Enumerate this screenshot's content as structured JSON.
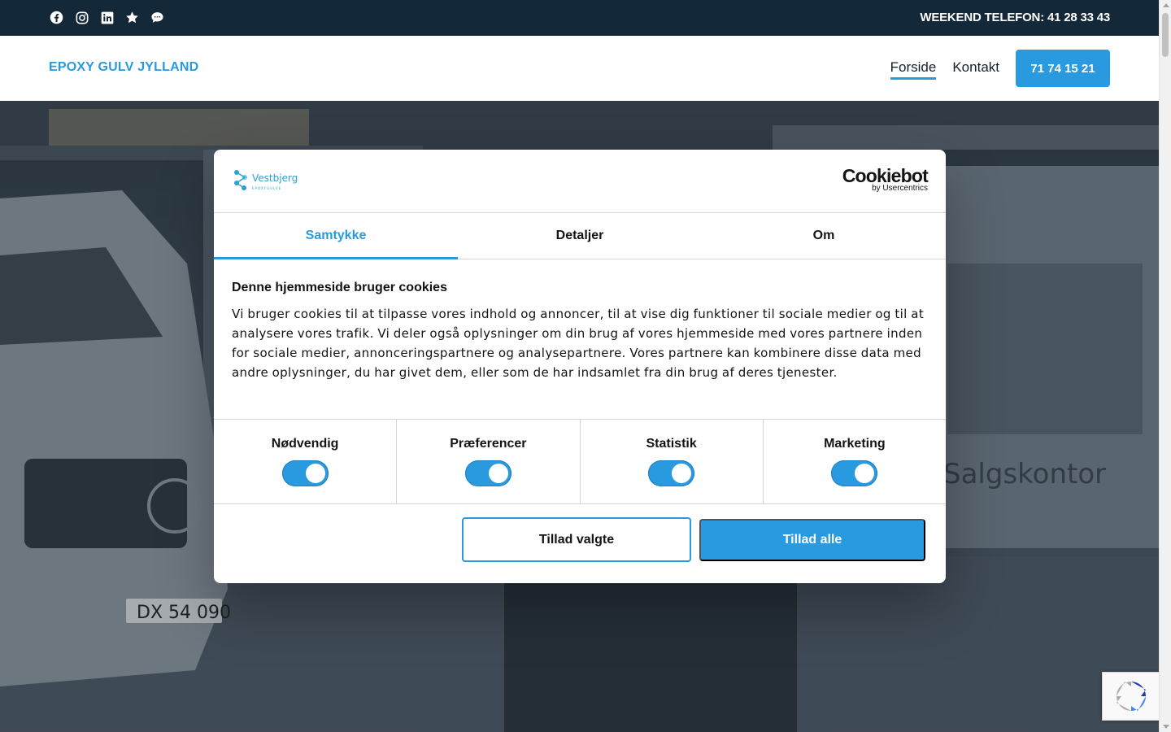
{
  "topbar": {
    "social_icons": [
      "facebook-icon",
      "instagram-icon",
      "linkedin-icon",
      "star-icon",
      "chat-icon"
    ],
    "weekend_phone": "WEEKEND TELEFON: 41 28 33 43"
  },
  "header": {
    "logo": "EPOXY GULV JYLLAND",
    "nav": [
      {
        "label": "Forside",
        "active": true
      },
      {
        "label": "Kontakt",
        "active": false
      }
    ],
    "phone_button": "71 74 15 21"
  },
  "hero": {
    "sign_text": "Salgskontor",
    "plate_text": "DX 54 090"
  },
  "cookie_dialog": {
    "brand_name": "Vestbjerg",
    "brand_sub": "EPOXYGULVE",
    "provider": "Cookiebot",
    "provider_sub": "by Usercentrics",
    "tabs": [
      {
        "label": "Samtykke",
        "active": true
      },
      {
        "label": "Detaljer",
        "active": false
      },
      {
        "label": "Om",
        "active": false
      }
    ],
    "title": "Denne hjemmeside bruger cookies",
    "text": "Vi bruger cookies til at tilpasse vores indhold og annoncer, til at vise dig funktioner til sociale medier og til at analysere vores trafik. Vi deler også oplysninger om din brug af vores hjemmeside med vores partnere inden for sociale medier, annonceringspartnere og analysepartnere. Vores partnere kan kombinere disse data med andre oplysninger, du har givet dem, eller som de har indsamlet fra din brug af deres tjenester.",
    "toggles": [
      {
        "label": "Nødvendig",
        "on": true
      },
      {
        "label": "Præferencer",
        "on": true
      },
      {
        "label": "Statistik",
        "on": true
      },
      {
        "label": "Marketing",
        "on": true
      }
    ],
    "allow_selected": "Tillad valgte",
    "allow_all": "Tillad alle"
  },
  "colors": {
    "accent": "#2a9ae0",
    "topbar": "#13293a"
  }
}
